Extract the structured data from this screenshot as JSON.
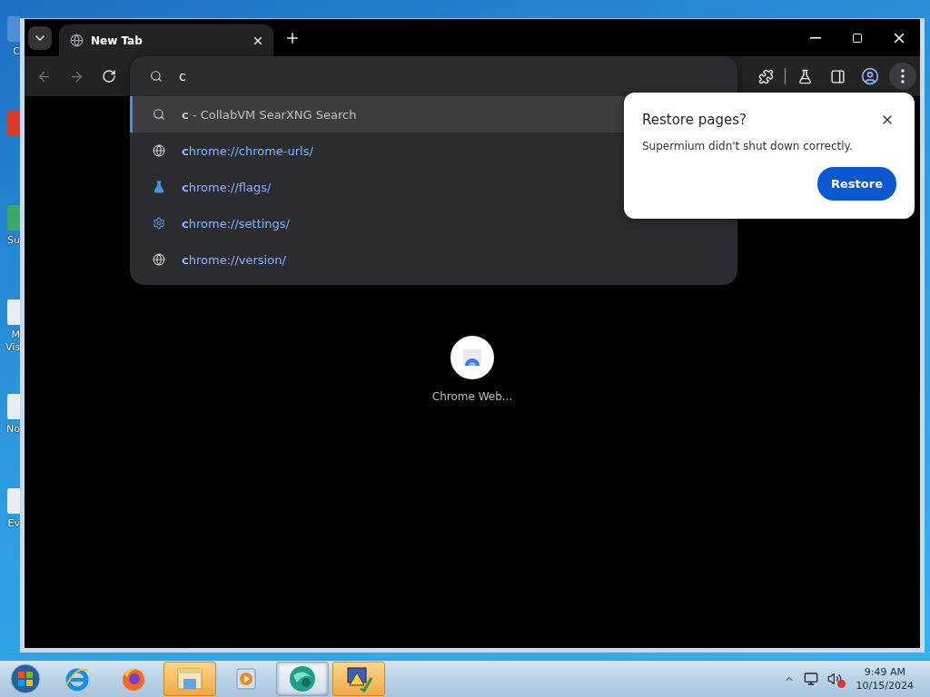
{
  "desktop": {
    "icons": [
      {
        "label": "C",
        "color": "#4a8fd8"
      },
      {
        "color": "#d83a2e"
      },
      {
        "label": "Su",
        "color": "#3aa86a"
      },
      {
        "label": "M Vis",
        "color": "#e8eef6"
      },
      {
        "label": "No",
        "color": "#e8eef6"
      },
      {
        "label": "Ev",
        "color": "#e8eef6"
      }
    ]
  },
  "browser": {
    "tabs": [
      {
        "title": "New Tab",
        "selected": true
      }
    ],
    "toolbar": {
      "back": {
        "disabled": true
      },
      "forward": {
        "disabled": true
      },
      "menu_button": {
        "pressed": true
      }
    },
    "omnibox": {
      "value": "c",
      "suggestions": [
        {
          "kind": "search",
          "text": "**c** - CollabVM SearXNG Search",
          "selected": true
        },
        {
          "kind": "globe",
          "text": "**c**hrome://chrome-urls/",
          "selected": false
        },
        {
          "kind": "flask",
          "text": "**c**hrome://flags/",
          "selected": false
        },
        {
          "kind": "gear",
          "text": "**c**hrome://settings/",
          "selected": false
        },
        {
          "kind": "globe",
          "text": "**c**hrome://version/",
          "selected": false
        }
      ]
    },
    "restore_bubble": {
      "title": "Restore pages?",
      "message": "Supermium didn't shut down correctly.",
      "button": "Restore"
    },
    "shortcuts": [
      {
        "label": "Chrome Web..."
      }
    ]
  },
  "taskbar": {
    "items": [
      {
        "kind": "ie",
        "selected": false,
        "flashing": false
      },
      {
        "kind": "firefox",
        "selected": false,
        "flashing": false
      },
      {
        "kind": "explorer",
        "selected": false,
        "flashing": true
      },
      {
        "kind": "media",
        "selected": false,
        "flashing": false
      },
      {
        "kind": "collab",
        "selected": true,
        "flashing": false
      },
      {
        "kind": "warning",
        "selected": false,
        "flashing": true
      }
    ],
    "tray": {
      "volume_muted": true
    },
    "clock": {
      "time": "9:49 AM",
      "date": "10/15/2024"
    }
  }
}
